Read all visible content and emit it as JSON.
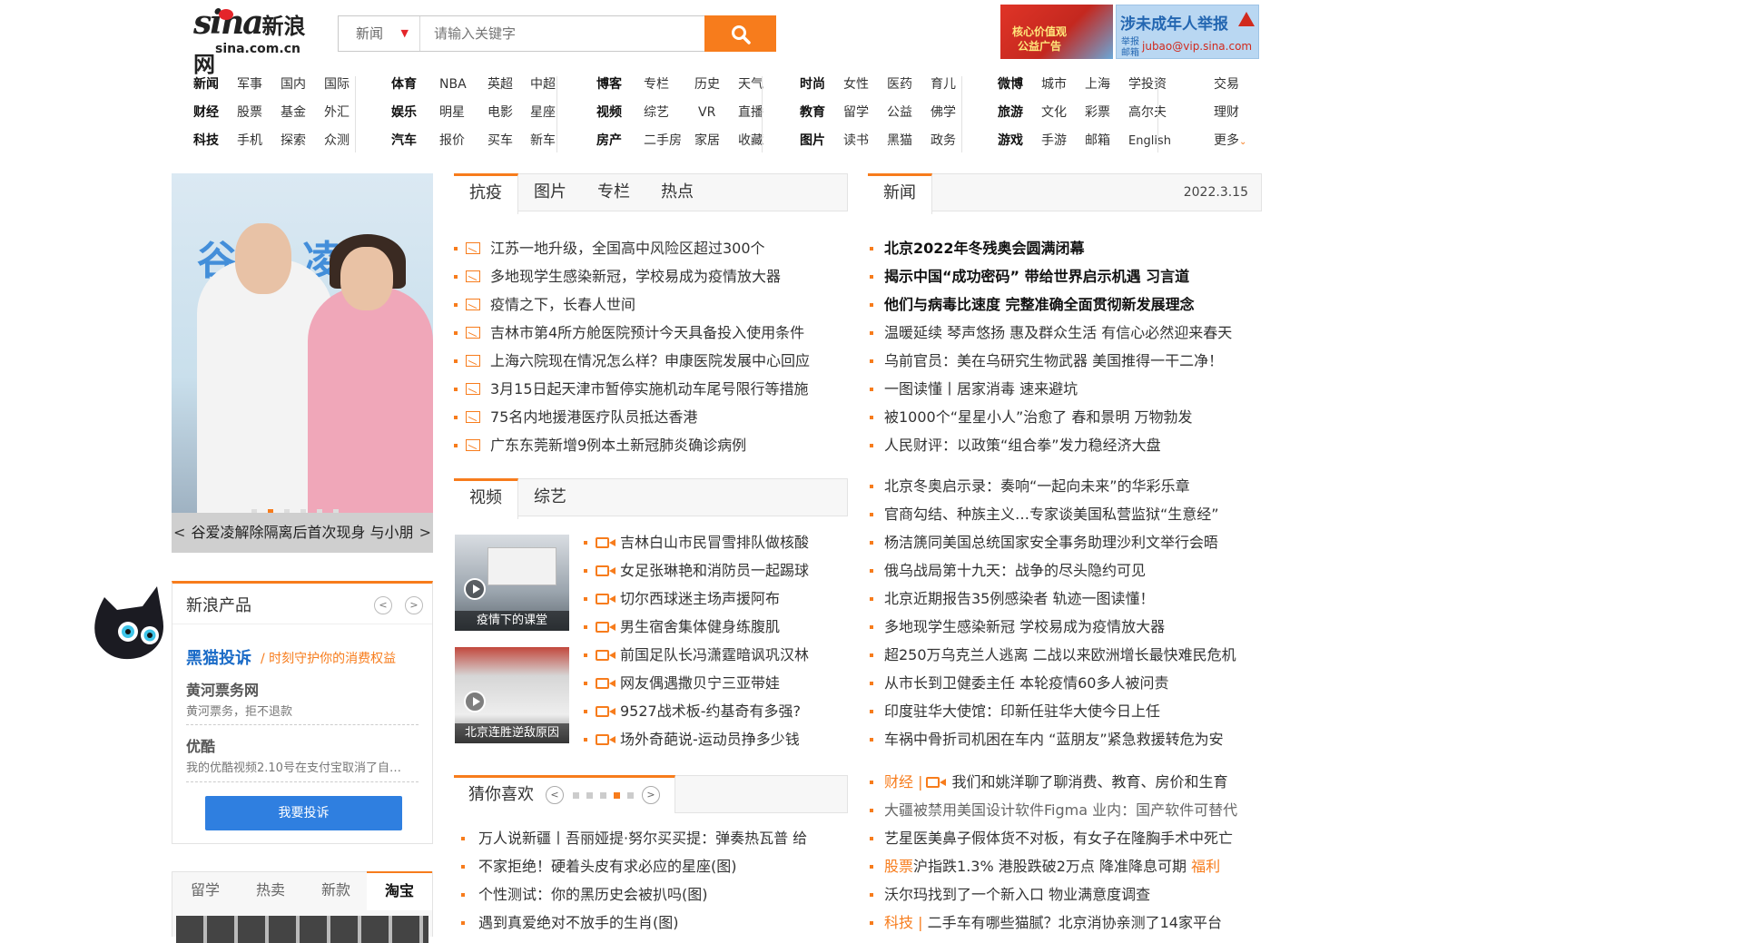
{
  "header": {
    "logo_word": "sina",
    "logo_cn": "新浪网",
    "logo_domain": "sina.com.cn",
    "search_category": "新闻",
    "search_placeholder": "请输入关键字",
    "ad1_text": "核心价值观 公益广告",
    "ad2_title": "涉未成年人举报",
    "ad2_small": "举报 邮箱",
    "ad2_email": "jubao@vip.sina.com"
  },
  "nav": {
    "col1": [
      [
        "新闻",
        "军事",
        "国内",
        "国际"
      ],
      [
        "财经",
        "股票",
        "基金",
        "外汇"
      ],
      [
        "科技",
        "手机",
        "探索",
        "众测"
      ]
    ],
    "col2": [
      [
        "体育",
        "NBA",
        "英超",
        "中超"
      ],
      [
        "娱乐",
        "明星",
        "电影",
        "星座"
      ],
      [
        "汽车",
        "报价",
        "买车",
        "新车"
      ]
    ],
    "col3": [
      [
        "博客",
        "专栏",
        "历史",
        "天气"
      ],
      [
        "视频",
        "综艺",
        "VR",
        "直播"
      ],
      [
        "房产",
        "二手房",
        "家居",
        "收藏"
      ]
    ],
    "col4": [
      [
        "时尚",
        "女性",
        "医药",
        "育儿"
      ],
      [
        "教育",
        "留学",
        "公益",
        "佛学"
      ],
      [
        "图片",
        "读书",
        "黑猫",
        "政务"
      ]
    ],
    "col5": [
      [
        "微博",
        "城市",
        "上海",
        "学投资"
      ],
      [
        "旅游",
        "文化",
        "彩票",
        "高尔夫"
      ],
      [
        "游戏",
        "手游",
        "邮箱",
        "English"
      ]
    ],
    "col6": [
      "交易",
      "理财",
      "更多"
    ]
  },
  "slider": {
    "banner_text": "谷爱凌慈善",
    "caption": "谷爱凌解除隔离后首次现身 与小朋",
    "prev": "<",
    "next": ">"
  },
  "products": {
    "title": "新浪产品",
    "prev": "<",
    "next": ">",
    "ts_name": "黑猫投诉",
    "ts_slogan": "/ 时刻守护你的消费权益",
    "item1_title": "黄河票务网",
    "item1_desc": "黄河票务，拒不退款",
    "item2_title": "优酷",
    "item2_desc": "我的优酷视频2.10号在支付宝取消了自…",
    "button": "我要投诉"
  },
  "shop_tabs": [
    "留学",
    "热卖",
    "新款",
    "淘宝"
  ],
  "epi": {
    "tabs": [
      "抗疫",
      "图片",
      "专栏",
      "热点"
    ],
    "items": [
      "江苏一地升级，全国高中风险区超过300个",
      "多地现学生感染新冠，学校易成为疫情放大器",
      "疫情之下，长春人世间",
      "吉林市第4所方舱医院预计今天具备投入使用条件",
      "上海六院现在情况怎么样？申康医院发展中心回应",
      "3月15日起天津市暂停实施机动车尾号限行等措施",
      "75名内地援港医疗队员抵达香港",
      "广东东莞新增9例本土新冠肺炎确诊病例"
    ]
  },
  "video": {
    "tabs": [
      "视频",
      "综艺"
    ],
    "thumb1_caption": "疫情下的课堂",
    "thumb2_caption": "北京连胜逆敌原因",
    "items": [
      "吉林白山市民冒雪排队做核酸",
      "女足张琳艳和消防员一起踢球",
      "切尔西球迷主场声援阿布",
      "男生宿舍集体健身练腹肌",
      "前国足队长冯潇霆暗讽巩汉林",
      "网友偶遇撒贝宁三亚带娃",
      "9527战术板-约基奇有多强?",
      "场外奇葩说-运动员挣多少钱"
    ]
  },
  "guess": {
    "title": "猜你喜欢",
    "items": [
      "万人说新疆丨吾丽娅提·努尔买买提：弹奏热瓦普 给",
      "不家拒绝！硬着头皮有求必应的星座(图)",
      "个性测试：你的黑历史会被扒吗(图)",
      "遇到真爱绝对不放手的生肖(图)"
    ]
  },
  "news": {
    "tab": "新闻",
    "date": "2022.3.15",
    "bold_items": [
      "北京2022年冬残奥会圆满闭幕",
      "揭示中国“成功密码” 带给世界启示机遇 习言道",
      "他们与病毒比速度 完整准确全面贯彻新发展理念"
    ],
    "items1": [
      "温暖延续 琴声悠扬 惠及群众生活 有信心必然迎来春天",
      "乌前官员：美在乌研究生物武器 美国推得一干二净！",
      "一图读懂丨居家消毒 速来避坑",
      "被1000个“星星小人”治愈了 春和景明 万物勃发",
      "人民财评：以政策“组合拳”发力稳经济大盘"
    ],
    "items2": [
      "北京冬奥启示录：奏响“一起向未来”的华彩乐章",
      "官商勾结、种族主义…专家谈美国私营监狱“生意经”",
      "杨洁篪同美国总统国家安全事务助理沙利文举行会晤",
      "俄乌战局第十九天：战争的尽头隐约可见",
      "北京近期报告35例感染者 轨迹一图读懂！",
      "多地现学生感染新冠 学校易成为疫情放大器",
      "超250万乌克兰人逃离 二战以来欧洲增长最快难民危机",
      "从市长到卫健委主任 本轮疫情60多人被问责",
      "印度驻华大使馆：印新任驻华大使今日上任",
      "车祸中骨折司机困在车内 “蓝朋友”紧急救援转危为安"
    ],
    "items3": [
      {
        "tag": "财经 |",
        "text": "我们和姚洋聊了聊消费、教育、房价和生育"
      },
      {
        "tag": "",
        "text": "大疆被禁用美国设计软件Figma 业内：国产软件可替代"
      },
      {
        "tag": "",
        "text": "艺星医美鼻子假体货不对板，有女子在隆胸手术中死亡"
      },
      {
        "tag": "股票",
        "text": "沪指跌1.3% 港股跌破2万点 降准降息可期",
        "tail": "福利"
      },
      {
        "tag": "",
        "text": "沃尔玛找到了一个新入口 物业满意度调查"
      },
      {
        "tag": "科技 |",
        "text": "二手车有哪些猫腻？北京消协亲测了14家平台"
      }
    ]
  }
}
